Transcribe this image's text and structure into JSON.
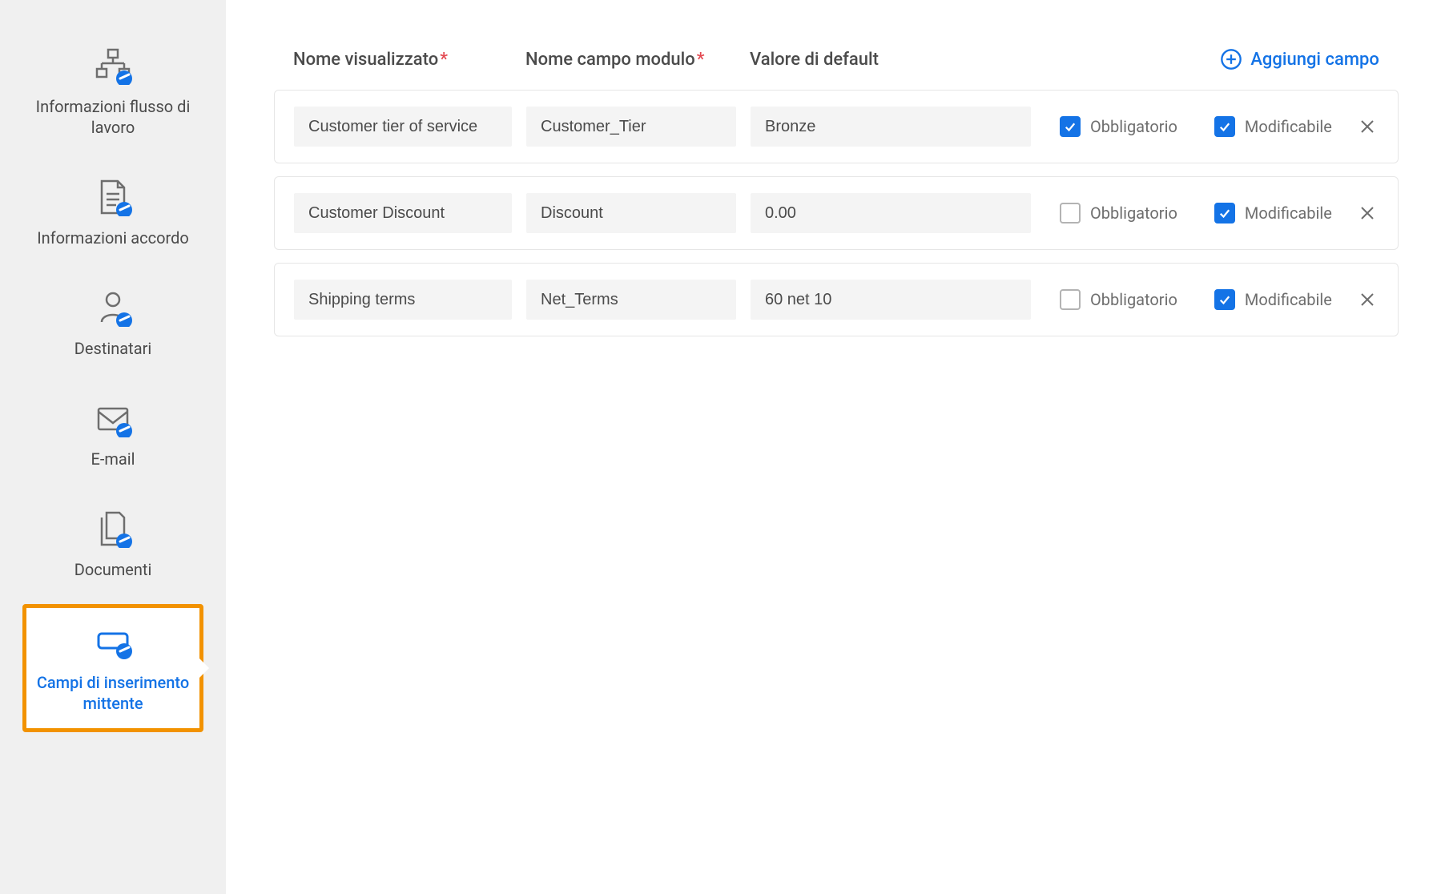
{
  "sidebar": {
    "items": [
      {
        "id": "workflow-info",
        "label": "Informazioni flusso di lavoro"
      },
      {
        "id": "agreement-info",
        "label": "Informazioni accordo"
      },
      {
        "id": "recipients",
        "label": "Destinatari"
      },
      {
        "id": "email",
        "label": "E-mail"
      },
      {
        "id": "documents",
        "label": "Documenti"
      },
      {
        "id": "sender-input-fields",
        "label": "Campi di inserimento mittente"
      }
    ]
  },
  "headers": {
    "display_name": "Nome visualizzato",
    "module_field_name": "Nome campo modulo",
    "default_value": "Valore di default"
  },
  "add_field_label": "Aggiungi campo",
  "checkbox_labels": {
    "required": "Obbligatorio",
    "editable": "Modificabile"
  },
  "fields": [
    {
      "display_name": "Customer tier of service",
      "module_name": "Customer_Tier",
      "default_value": "Bronze",
      "required": true,
      "editable": true
    },
    {
      "display_name": "Customer Discount",
      "module_name": "Discount",
      "default_value": "0.00",
      "required": false,
      "editable": true
    },
    {
      "display_name": "Shipping terms",
      "module_name": "Net_Terms",
      "default_value": "60 net 10",
      "required": false,
      "editable": true
    }
  ]
}
